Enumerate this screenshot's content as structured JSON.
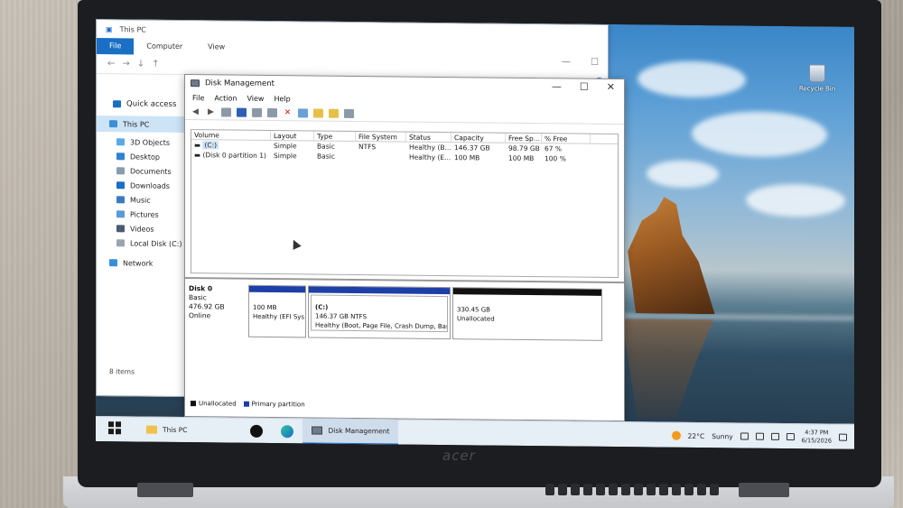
{
  "explorer": {
    "title": "This PC",
    "ribbon_tabs": [
      "File",
      "Computer",
      "View"
    ],
    "nav_glyphs": [
      "←",
      "→",
      "↓",
      "↑"
    ],
    "help_glyph": "?",
    "window_buttons": [
      "—",
      "☐"
    ],
    "sidebar": {
      "quick_access": "Quick access",
      "this_pc": "This PC",
      "items": [
        "3D Objects",
        "Desktop",
        "Documents",
        "Downloads",
        "Music",
        "Pictures",
        "Videos",
        "Local Disk (C:)"
      ],
      "network": "Network"
    },
    "status": "8 items"
  },
  "desktop": {
    "recycle_bin": "Recycle Bin"
  },
  "disk_management": {
    "title": "Disk Management",
    "menu": [
      "File",
      "Action",
      "View",
      "Help"
    ],
    "window_buttons": [
      "—",
      "☐",
      "✕"
    ],
    "columns": [
      "Volume",
      "Layout",
      "Type",
      "File System",
      "Status",
      "Capacity",
      "Free Sp...",
      "% Free"
    ],
    "rows": [
      {
        "volume": "(C:)",
        "layout": "Simple",
        "type": "Basic",
        "fs": "NTFS",
        "status": "Healthy (B...",
        "capacity": "146.37 GB",
        "free": "98.79 GB",
        "pct": "67 %"
      },
      {
        "volume": "(Disk 0 partition 1)",
        "layout": "Simple",
        "type": "Basic",
        "fs": "",
        "status": "Healthy (E...",
        "capacity": "100 MB",
        "free": "100 MB",
        "pct": "100 %"
      }
    ],
    "disk": {
      "name": "Disk 0",
      "type": "Basic",
      "size": "476.92 GB",
      "state": "Online",
      "partitions": [
        {
          "line1": "100 MB",
          "line2": "Healthy (EFI Sys"
        },
        {
          "label": "(C:)",
          "line1": "146.37 GB NTFS",
          "line2": "Healthy (Boot, Page File, Crash Dump, Basic D"
        },
        {
          "line1": "330.45 GB",
          "line2": "Unallocated"
        }
      ]
    },
    "legend": [
      "Unallocated",
      "Primary partition"
    ]
  },
  "taskbar": {
    "items": [
      "This PC",
      "Disk Management"
    ],
    "weather_temp": "22°C",
    "weather_desc": "Sunny",
    "time": "4:37 PM",
    "date": "6/15/2026"
  },
  "laptop_brand": "acer",
  "colors": {
    "primary_partition": "#1d3fa8",
    "unallocated": "#111111",
    "accent": "#1a6fc4"
  }
}
